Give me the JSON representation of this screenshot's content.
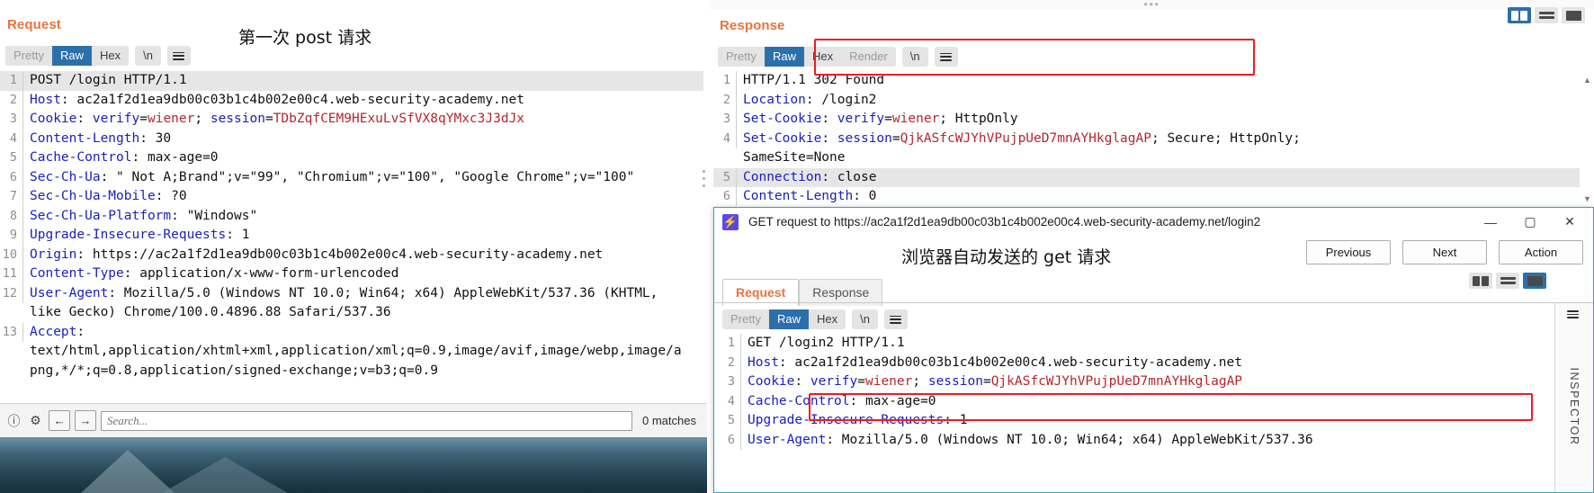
{
  "left": {
    "title": "Request",
    "annotation": "第一次 post 请求",
    "tabs": [
      {
        "label": "Pretty",
        "active": false,
        "dim": true
      },
      {
        "label": "Raw",
        "active": true,
        "dim": false
      },
      {
        "label": "Hex",
        "active": false,
        "dim": false
      }
    ],
    "newline_label": "\\n",
    "lines": [
      {
        "n": "1",
        "highlight": true,
        "parts": [
          {
            "t": "POST /login HTTP/1.1",
            "c": "v"
          }
        ]
      },
      {
        "n": "2",
        "parts": [
          {
            "t": "Host",
            "c": "k"
          },
          {
            "t": ": ac2a1f2d1ea9db00c03b1c4b002e00c4.web-security-academy.net",
            "c": "v"
          }
        ]
      },
      {
        "n": "3",
        "parts": [
          {
            "t": "Cookie",
            "c": "k"
          },
          {
            "t": ": ",
            "c": "v"
          },
          {
            "t": "verify",
            "c": "ck"
          },
          {
            "t": "=",
            "c": "v"
          },
          {
            "t": "wiener",
            "c": "cv"
          },
          {
            "t": "; ",
            "c": "v"
          },
          {
            "t": "session",
            "c": "ck"
          },
          {
            "t": "=",
            "c": "v"
          },
          {
            "t": "TDbZqfCEM9HExuLvSfVX8qYMxc3J3dJx",
            "c": "cv"
          }
        ]
      },
      {
        "n": "4",
        "parts": [
          {
            "t": "Content-Length",
            "c": "k"
          },
          {
            "t": ": 30",
            "c": "v"
          }
        ]
      },
      {
        "n": "5",
        "parts": [
          {
            "t": "Cache-Control",
            "c": "k"
          },
          {
            "t": ": max-age=0",
            "c": "v"
          }
        ]
      },
      {
        "n": "6",
        "parts": [
          {
            "t": "Sec-Ch-Ua",
            "c": "k"
          },
          {
            "t": ": \" Not A;Brand\";v=\"99\", \"Chromium\";v=\"100\", \"Google Chrome\";v=\"100\"",
            "c": "v"
          }
        ]
      },
      {
        "n": "7",
        "parts": [
          {
            "t": "Sec-Ch-Ua-Mobile",
            "c": "k"
          },
          {
            "t": ": ?0",
            "c": "v"
          }
        ]
      },
      {
        "n": "8",
        "parts": [
          {
            "t": "Sec-Ch-Ua-Platform",
            "c": "k"
          },
          {
            "t": ": \"Windows\"",
            "c": "v"
          }
        ]
      },
      {
        "n": "9",
        "parts": [
          {
            "t": "Upgrade-Insecure-Requests",
            "c": "k"
          },
          {
            "t": ": 1",
            "c": "v"
          }
        ]
      },
      {
        "n": "10",
        "parts": [
          {
            "t": "Origin",
            "c": "k"
          },
          {
            "t": ": https://ac2a1f2d1ea9db00c03b1c4b002e00c4.web-security-academy.net",
            "c": "v"
          }
        ]
      },
      {
        "n": "11",
        "parts": [
          {
            "t": "Content-Type",
            "c": "k"
          },
          {
            "t": ": application/x-www-form-urlencoded",
            "c": "v"
          }
        ]
      },
      {
        "n": "12",
        "parts": [
          {
            "t": "User-Agent",
            "c": "k"
          },
          {
            "t": ": Mozilla/5.0 (Windows NT 10.0; Win64; x64) AppleWebKit/537.36 (KHTML,",
            "c": "v"
          }
        ]
      },
      {
        "n": "",
        "parts": [
          {
            "t": "like Gecko) Chrome/100.0.4896.88 Safari/537.36",
            "c": "v"
          }
        ]
      },
      {
        "n": "13",
        "parts": [
          {
            "t": "Accept",
            "c": "k"
          },
          {
            "t": ":",
            "c": "v"
          }
        ]
      },
      {
        "n": "",
        "parts": [
          {
            "t": "text/html,application/xhtml+xml,application/xml;q=0.9,image/avif,image/webp,image/a",
            "c": "v"
          }
        ]
      },
      {
        "n": "",
        "parts": [
          {
            "t": "png,*/*;q=0.8,application/signed-exchange;v=b3;q=0.9",
            "c": "v"
          }
        ]
      }
    ],
    "search": {
      "placeholder": "Search...",
      "value": "",
      "matches": "0 matches",
      "help_icon": "question-mark-icon",
      "settings_icon": "gear-icon",
      "prev_icon": "←",
      "next_icon": "→"
    }
  },
  "right": {
    "title": "Response",
    "tabs": [
      {
        "label": "Pretty",
        "active": false,
        "dim": true
      },
      {
        "label": "Raw",
        "active": true,
        "dim": false
      },
      {
        "label": "Hex",
        "active": false,
        "dim": false
      },
      {
        "label": "Render",
        "active": false,
        "dim": true
      }
    ],
    "newline_label": "\\n",
    "lines": [
      {
        "n": "1",
        "parts": [
          {
            "t": "HTTP/1.1 302 Found",
            "c": "v"
          }
        ]
      },
      {
        "n": "2",
        "parts": [
          {
            "t": "Location",
            "c": "k"
          },
          {
            "t": ": /login2",
            "c": "v"
          }
        ]
      },
      {
        "n": "3",
        "parts": [
          {
            "t": "Set-Cookie",
            "c": "k"
          },
          {
            "t": ": ",
            "c": "v"
          },
          {
            "t": "verify",
            "c": "ck"
          },
          {
            "t": "=",
            "c": "v"
          },
          {
            "t": "wiener",
            "c": "cv"
          },
          {
            "t": "; HttpOnly",
            "c": "v"
          }
        ]
      },
      {
        "n": "4",
        "parts": [
          {
            "t": "Set-Cookie",
            "c": "k"
          },
          {
            "t": ": ",
            "c": "v"
          },
          {
            "t": "session",
            "c": "ck"
          },
          {
            "t": "=",
            "c": "v"
          },
          {
            "t": "QjkASfcWJYhVPujpUeD7mnAYHkglagAP",
            "c": "cv"
          },
          {
            "t": "; Secure; HttpOnly;",
            "c": "v"
          }
        ]
      },
      {
        "n": "",
        "parts": [
          {
            "t": "SameSite=None",
            "c": "v"
          }
        ]
      },
      {
        "n": "5",
        "highlight": true,
        "parts": [
          {
            "t": "Connection",
            "c": "k"
          },
          {
            "t": ": close",
            "c": "v"
          }
        ]
      },
      {
        "n": "6",
        "parts": [
          {
            "t": "Content-Length",
            "c": "k"
          },
          {
            "t": ": 0",
            "c": "v"
          }
        ]
      }
    ],
    "view_modes": [
      {
        "name": "split-vertical-view",
        "active": true
      },
      {
        "name": "split-horizontal-view",
        "active": false
      },
      {
        "name": "single-pane-view",
        "active": false
      }
    ]
  },
  "popup": {
    "title": "GET request to https://ac2a1f2d1ea9db00c03b1c4b002e00c4.web-security-academy.net/login2",
    "annotation": "浏览器自动发送的 get 请求",
    "window_buttons": [
      {
        "name": "minimize-button",
        "glyph": "—"
      },
      {
        "name": "maximize-button",
        "glyph": "▢"
      },
      {
        "name": "close-button",
        "glyph": "✕"
      }
    ],
    "actions": [
      {
        "label": "Previous"
      },
      {
        "label": "Next"
      },
      {
        "label": "Action"
      }
    ],
    "tabs": [
      {
        "label": "Request",
        "active": true
      },
      {
        "label": "Response",
        "active": false
      }
    ],
    "view_modes": [
      {
        "name": "split-vertical-view",
        "active": false
      },
      {
        "name": "split-horizontal-view",
        "active": false
      },
      {
        "name": "single-pane-view",
        "active": true
      }
    ],
    "format_tabs": [
      {
        "label": "Pretty",
        "active": false,
        "dim": true
      },
      {
        "label": "Raw",
        "active": true,
        "dim": false
      },
      {
        "label": "Hex",
        "active": false,
        "dim": false
      }
    ],
    "newline_label": "\\n",
    "lines": [
      {
        "n": "1",
        "parts": [
          {
            "t": "GET /login2 HTTP/1.1",
            "c": "v"
          }
        ]
      },
      {
        "n": "2",
        "parts": [
          {
            "t": "Host",
            "c": "k"
          },
          {
            "t": ": ac2a1f2d1ea9db00c03b1c4b002e00c4.web-security-academy.net",
            "c": "v"
          }
        ]
      },
      {
        "n": "3",
        "parts": [
          {
            "t": "Cookie",
            "c": "k"
          },
          {
            "t": ": ",
            "c": "v"
          },
          {
            "t": "verify",
            "c": "ck"
          },
          {
            "t": "=",
            "c": "v"
          },
          {
            "t": "wiener",
            "c": "cv"
          },
          {
            "t": "; ",
            "c": "v"
          },
          {
            "t": "session",
            "c": "ck"
          },
          {
            "t": "=",
            "c": "v"
          },
          {
            "t": "QjkASfcWJYhVPujpUeD7mnAYHkglagAP",
            "c": "cv"
          }
        ]
      },
      {
        "n": "4",
        "parts": [
          {
            "t": "Cache-Control",
            "c": "k"
          },
          {
            "t": ": max-age=0",
            "c": "v"
          }
        ]
      },
      {
        "n": "5",
        "parts": [
          {
            "t": "Upgrade-Insecure-Requests",
            "c": "k"
          },
          {
            "t": ": 1",
            "c": "v"
          }
        ]
      },
      {
        "n": "6",
        "parts": [
          {
            "t": "User-Agent",
            "c": "k"
          },
          {
            "t": ": Mozilla/5.0 (Windows NT 10.0; Win64; x64) AppleWebKit/537.36",
            "c": "v"
          }
        ]
      }
    ],
    "inspector_label": "INSPECTOR"
  },
  "colors": {
    "accent_orange": "#e8743b",
    "tab_active_blue": "#2c6fad",
    "annotation_red": "#ee1c25",
    "header_blue": "#1a21bd",
    "cookie_value_red": "#b4272d",
    "popup_border": "#2aa8c4",
    "burp_logo": "#5a4ae3"
  }
}
